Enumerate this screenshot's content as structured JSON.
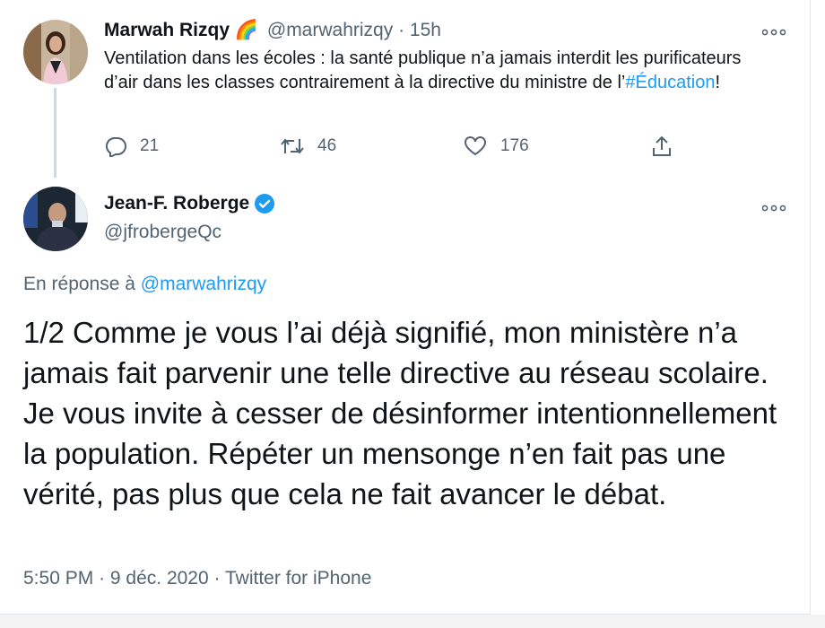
{
  "tweet1": {
    "author_name": "Marwah Rizqy",
    "emoji": "🌈",
    "handle": "@marwahrizqy",
    "separator": "·",
    "time": "15h",
    "text_before": "Ventilation dans les écoles : la santé publique n’a jamais interdit les purificateurs d’air dans les classes contrairement à la directive du ministre de l’",
    "hashtag": "#Éducation",
    "text_after": "!",
    "replies": "21",
    "retweets": "46",
    "likes": "176"
  },
  "tweet2": {
    "author_name": "Jean-F. Roberge",
    "handle": "@jfrobergeQc",
    "reply_prefix": "En réponse à",
    "reply_to": "@marwahrizqy",
    "text": "1/2 Comme je vous l’ai déjà signifié, mon ministère n’a jamais fait parvenir une telle directive au réseau scolaire. Je vous invite à cesser de désinformer intentionnellement la population. Répéter un mensonge n’en fait pas une vérité, pas plus que cela ne fait avancer le débat.",
    "time": "5:50 PM",
    "date": "9 déc. 2020",
    "source": "Twitter for iPhone",
    "sep": "·"
  },
  "colors": {
    "link": "#1d9bf0",
    "muted": "#536471",
    "verified": "#1d9bf0"
  }
}
